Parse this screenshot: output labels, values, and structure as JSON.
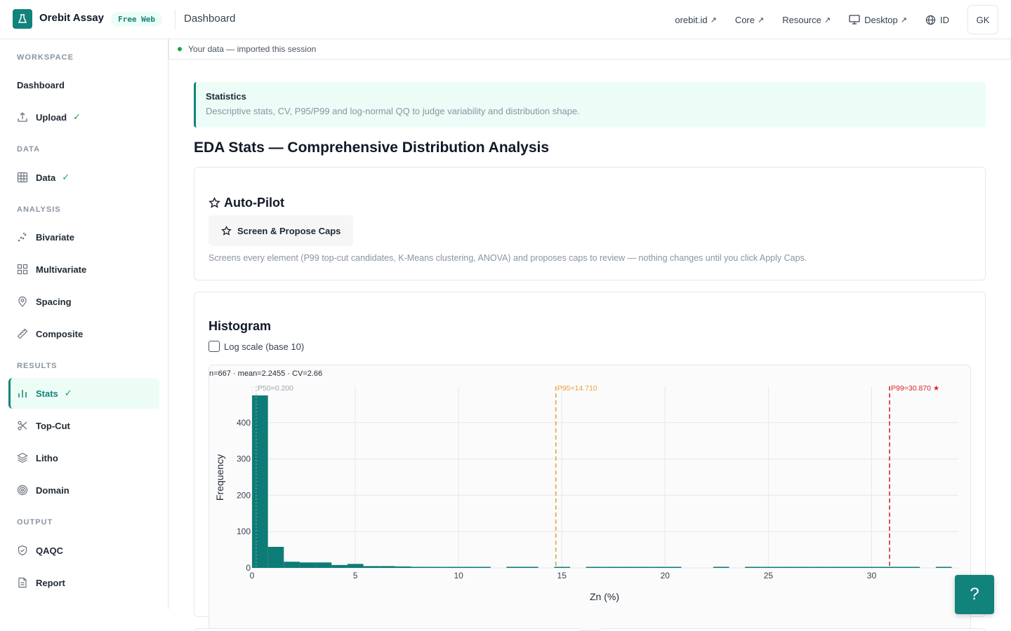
{
  "header": {
    "app_name": "Orebit Assay",
    "plan_badge": "Free Web",
    "page_title": "Dashboard",
    "links": [
      {
        "label": "orebit.id",
        "icon": "external-link-icon"
      },
      {
        "label": "Core",
        "icon": "external-link-icon"
      },
      {
        "label": "Resource",
        "icon": "external-link-icon"
      },
      {
        "label": "Desktop",
        "icon": "monitor-icon"
      },
      {
        "label": "ID",
        "icon": "globe-icon"
      }
    ],
    "avatar": "GK",
    "ext_arrow": "↗"
  },
  "sidebar": {
    "sections": {
      "workspace": "WORKSPACE",
      "data": "DATA",
      "analysis": "ANALYSIS",
      "results": "RESULTS",
      "output": "OUTPUT"
    },
    "items": [
      {
        "label": "Dashboard",
        "icon": "",
        "done": false
      },
      {
        "label": "Upload",
        "icon": "upload-icon",
        "done": true
      },
      {
        "label": "Data",
        "icon": "table-icon",
        "done": true
      },
      {
        "label": "Bivariate",
        "icon": "scatter-icon",
        "done": false
      },
      {
        "label": "Multivariate",
        "icon": "grid-icon",
        "done": false
      },
      {
        "label": "Spacing",
        "icon": "map-pin-icon",
        "done": false
      },
      {
        "label": "Composite",
        "icon": "ruler-icon",
        "done": false
      },
      {
        "label": "Stats",
        "icon": "bar-chart-icon",
        "done": true,
        "active": true
      },
      {
        "label": "Top-Cut",
        "icon": "scissors-icon",
        "done": false
      },
      {
        "label": "Litho",
        "icon": "layers-icon",
        "done": false
      },
      {
        "label": "Domain",
        "icon": "target-icon",
        "done": false
      },
      {
        "label": "QAQC",
        "icon": "shield-check-icon",
        "done": false
      },
      {
        "label": "Report",
        "icon": "file-icon",
        "done": false
      }
    ],
    "check": "✓"
  },
  "status": {
    "text": "Your data — imported this session",
    "color": "#16a34a"
  },
  "info": {
    "title": "Statistics",
    "description": "Descriptive stats, CV, P95/P99 and log-normal QQ to judge variability and distribution shape."
  },
  "main": {
    "title": "EDA Stats — Comprehensive Distribution Analysis"
  },
  "autopilot": {
    "title": "Auto-Pilot",
    "button": "Screen & Propose Caps",
    "note": "Screens every element (P99 top-cut candidates, K-Means clustering, ANOVA) and proposes caps to review — nothing changes until you click Apply Caps."
  },
  "histogram": {
    "title": "Histogram",
    "log_scale_label": "Log scale (base 10)",
    "log_scale_checked": false
  },
  "chart_data": {
    "type": "bar",
    "summary": "n=667 · mean=2.2455 · CV=2.66",
    "xlabel": "Zn (%)",
    "ylabel": "Frequency",
    "xlim": [
      0,
      34.2
    ],
    "ylim": [
      0,
      500
    ],
    "x_ticks": [
      0,
      5,
      10,
      15,
      20,
      25,
      30
    ],
    "y_ticks": [
      0,
      100,
      200,
      300,
      400
    ],
    "bin_width": 0.77,
    "bins": [
      {
        "x0": 0.0,
        "count": 475
      },
      {
        "x0": 0.77,
        "count": 58
      },
      {
        "x0": 1.54,
        "count": 17
      },
      {
        "x0": 2.31,
        "count": 15
      },
      {
        "x0": 3.08,
        "count": 15
      },
      {
        "x0": 3.85,
        "count": 8
      },
      {
        "x0": 4.62,
        "count": 11
      },
      {
        "x0": 5.39,
        "count": 5
      },
      {
        "x0": 6.16,
        "count": 5
      },
      {
        "x0": 6.93,
        "count": 4
      },
      {
        "x0": 7.7,
        "count": 3
      },
      {
        "x0": 8.47,
        "count": 1
      },
      {
        "x0": 9.24,
        "count": 1
      },
      {
        "x0": 10.01,
        "count": 1
      },
      {
        "x0": 10.78,
        "count": 1
      },
      {
        "x0": 11.55,
        "count": 0
      },
      {
        "x0": 12.32,
        "count": 3
      },
      {
        "x0": 13.09,
        "count": 3
      },
      {
        "x0": 13.86,
        "count": 0
      },
      {
        "x0": 14.63,
        "count": 1
      },
      {
        "x0": 15.4,
        "count": 0
      },
      {
        "x0": 16.17,
        "count": 1
      },
      {
        "x0": 16.94,
        "count": 1
      },
      {
        "x0": 17.71,
        "count": 2
      },
      {
        "x0": 18.48,
        "count": 1
      },
      {
        "x0": 19.25,
        "count": 1
      },
      {
        "x0": 20.02,
        "count": 1
      },
      {
        "x0": 20.79,
        "count": 0
      },
      {
        "x0": 21.56,
        "count": 0
      },
      {
        "x0": 22.33,
        "count": 3
      },
      {
        "x0": 23.1,
        "count": 0
      },
      {
        "x0": 23.87,
        "count": 1
      },
      {
        "x0": 24.64,
        "count": 1
      },
      {
        "x0": 25.41,
        "count": 1
      },
      {
        "x0": 26.18,
        "count": 1
      },
      {
        "x0": 26.95,
        "count": 1
      },
      {
        "x0": 27.72,
        "count": 1
      },
      {
        "x0": 28.49,
        "count": 1
      },
      {
        "x0": 29.26,
        "count": 1
      },
      {
        "x0": 30.03,
        "count": 1
      },
      {
        "x0": 30.8,
        "count": 1
      },
      {
        "x0": 31.57,
        "count": 1
      },
      {
        "x0": 32.34,
        "count": 0
      },
      {
        "x0": 33.11,
        "count": 1
      }
    ],
    "reference_lines": [
      {
        "label": "P50=0.200",
        "value": 0.2,
        "color": "#9ca3af"
      },
      {
        "label": "P95=14.710",
        "value": 14.71,
        "color": "#e8a23a"
      },
      {
        "label": "P99=30.870 ★",
        "value": 30.87,
        "color": "#dc2626"
      }
    ],
    "bar_color": "#0e7c76",
    "grid": true
  },
  "help": {
    "label": "?"
  }
}
